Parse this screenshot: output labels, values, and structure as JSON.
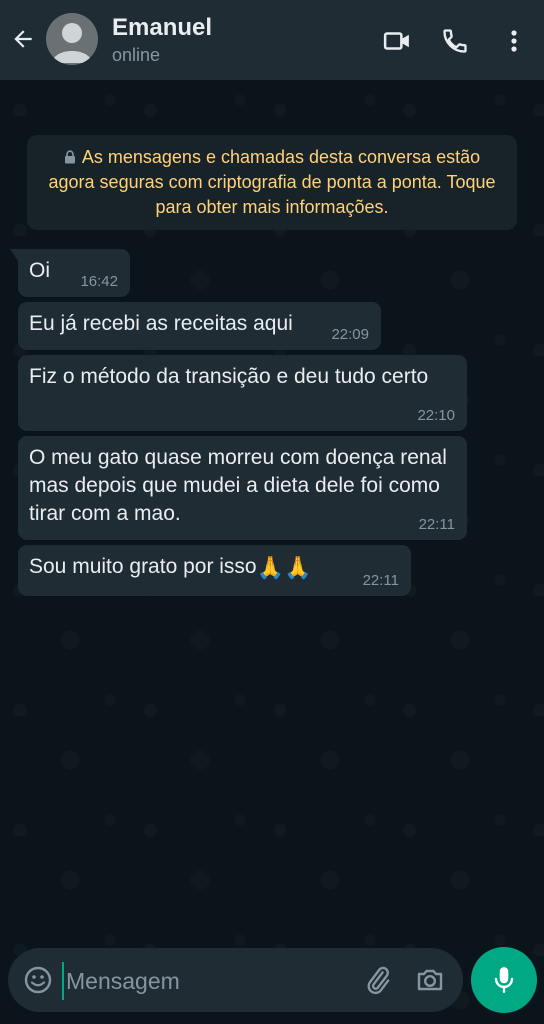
{
  "header": {
    "contact_name": "Emanuel",
    "status": "online"
  },
  "encryption_notice": {
    "text": "As mensagens e chamadas desta conversa estão agora seguras com criptografia de ponta a ponta. Toque para obter mais informações."
  },
  "messages": [
    {
      "text": "Oi",
      "time": "16:42"
    },
    {
      "text": "Eu já recebi as receitas aqui",
      "time": "22:09"
    },
    {
      "text": "Fiz o método da transição e deu tudo certo",
      "time": "22:10"
    },
    {
      "text": "O meu gato quase morreu com doença renal mas depois que mudei a dieta dele foi como tirar com a mao.",
      "time": "22:11"
    },
    {
      "text": "Sou muito grato por isso",
      "emoji": "🙏🙏",
      "time": "22:11"
    }
  ],
  "composer": {
    "placeholder": "Mensagem"
  },
  "icons": {
    "back": "back-arrow-icon",
    "video": "video-call-icon",
    "call": "phone-call-icon",
    "menu": "more-vert-icon",
    "emoji": "emoji-icon",
    "attach": "paperclip-icon",
    "camera": "camera-icon",
    "mic": "microphone-icon"
  },
  "colors": {
    "header_bg": "#1f2c34",
    "chat_bg": "#0b141a",
    "bubble_incoming": "#202c33",
    "notice_text": "#ffd279",
    "accent": "#00a884",
    "secondary_text": "#8696a0"
  }
}
